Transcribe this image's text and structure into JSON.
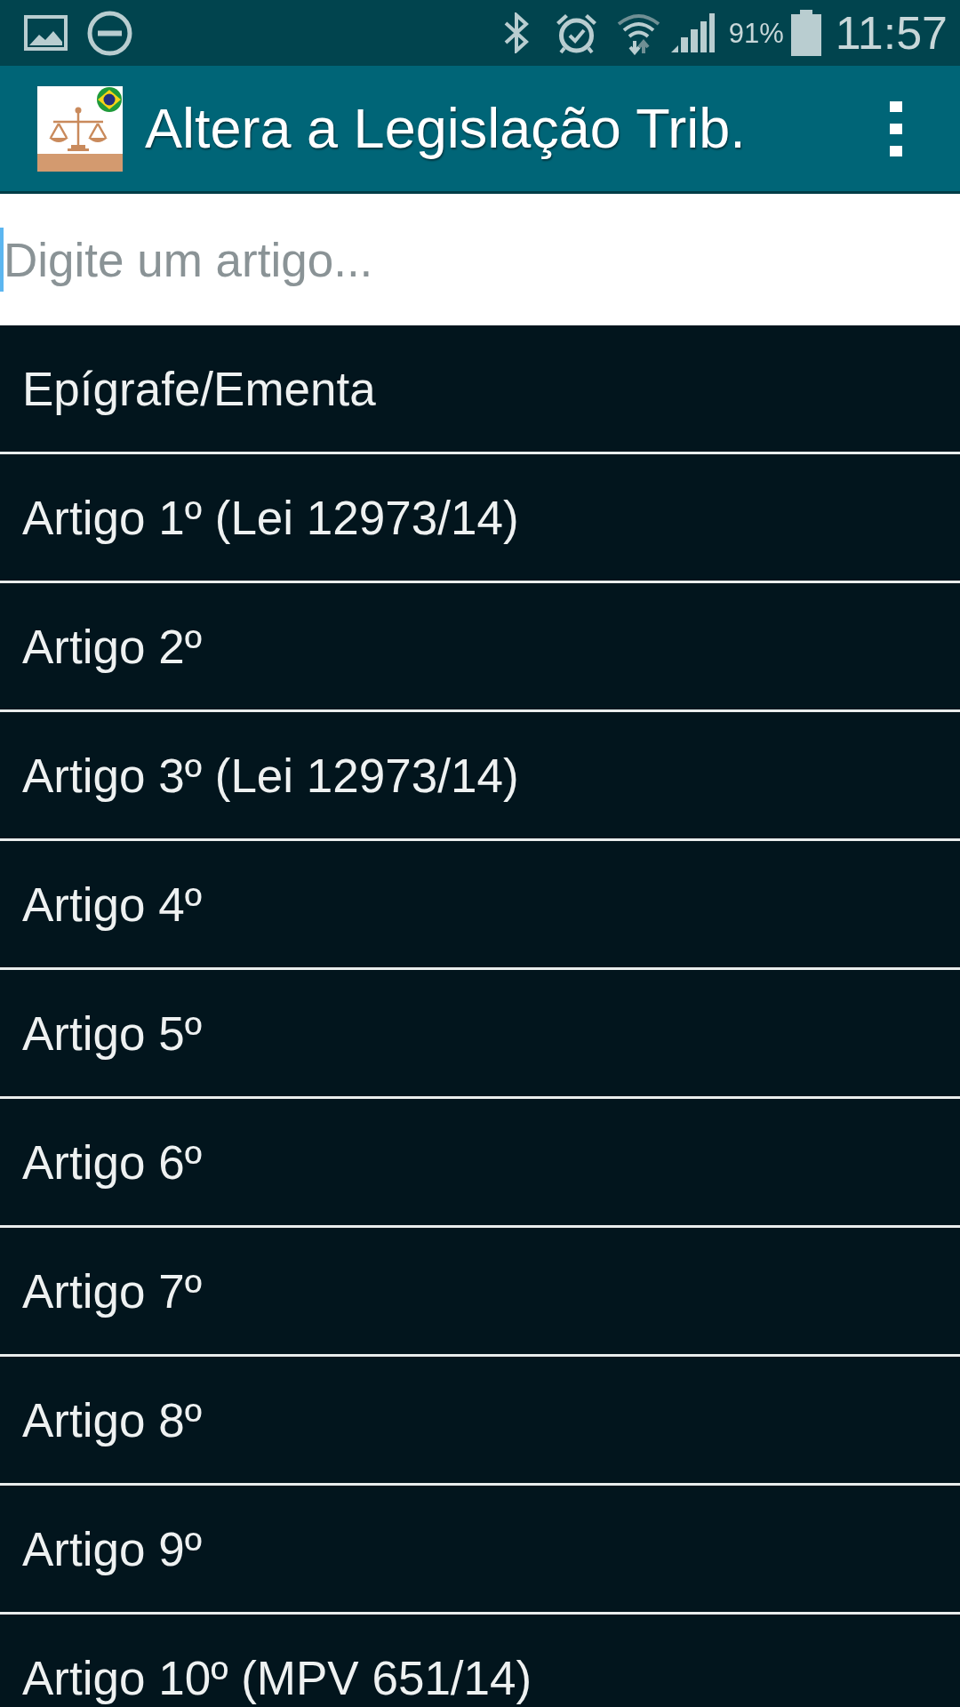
{
  "status_bar": {
    "battery": "91%",
    "time": "11:57"
  },
  "app_bar": {
    "title": "Altera a Legislação Trib."
  },
  "search": {
    "placeholder": "Digite um artigo..."
  },
  "articles": [
    {
      "label": "Epígrafe/Ementa"
    },
    {
      "label": "Artigo 1º (Lei 12973/14)"
    },
    {
      "label": "Artigo 2º"
    },
    {
      "label": "Artigo 3º (Lei 12973/14)"
    },
    {
      "label": "Artigo 4º"
    },
    {
      "label": "Artigo 5º"
    },
    {
      "label": "Artigo 6º"
    },
    {
      "label": "Artigo 7º"
    },
    {
      "label": "Artigo 8º"
    },
    {
      "label": "Artigo 9º"
    },
    {
      "label": "Artigo 10º (MPV 651/14)"
    }
  ]
}
